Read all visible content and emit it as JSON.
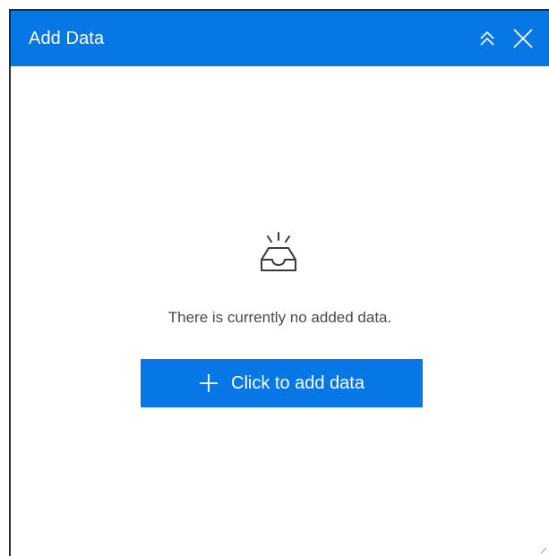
{
  "panel": {
    "title": "Add Data",
    "collapse_icon": "double-chevron-up-icon",
    "close_icon": "close-icon"
  },
  "empty_state": {
    "icon": "empty-inbox-icon",
    "message": "There is currently no added data."
  },
  "add_button": {
    "icon": "plus-icon",
    "label": "Click to add data"
  },
  "colors": {
    "accent": "#0777e6",
    "text": "#4a4a4a",
    "icon_stroke": "#3a3a3a"
  }
}
